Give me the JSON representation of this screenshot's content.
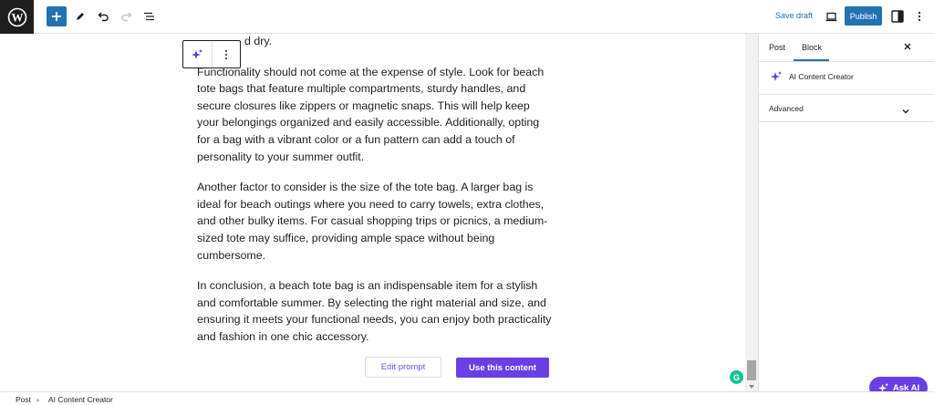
{
  "toolbar": {
    "save_draft": "Save draft",
    "publish": "Publish"
  },
  "editor": {
    "partial_line": "d dry.",
    "paragraphs": [
      "Functionality should not come at the expense of style. Look for beach tote bags that feature multiple compartments, sturdy handles, and secure closures like zippers or magnetic snaps. This will help keep your belongings organized and easily accessible. Additionally, opting for a bag with a vibrant color or a fun pattern can add a touch of personality to your summer outfit.",
      "Another factor to consider is the size of the tote bag. A larger bag is ideal for beach outings where you need to carry towels, extra clothes, and other bulky items. For casual shopping trips or picnics, a medium-sized tote may suffice, providing ample space without being cumbersome.",
      "In conclusion, a beach tote bag is an indispensable item for a stylish and comfortable summer. By selecting the right material and size, and ensuring it meets your functional needs, you can enjoy both practicality and fashion in one chic accessory."
    ],
    "edit_prompt": "Edit prompt",
    "use_content": "Use this content"
  },
  "sidebar": {
    "tab_post": "Post",
    "tab_block": "Block",
    "block_name": "AI Content Creator",
    "advanced": "Advanced"
  },
  "ask_ai": "Ask AI",
  "grammarly_letter": "G",
  "breadcrumb": {
    "root": "Post",
    "separator": "›",
    "current": "AI Content Creator"
  },
  "colors": {
    "wp_blue": "#2271b1",
    "ai_purple": "#6a3fe6",
    "grammarly_green": "#15c39a"
  }
}
